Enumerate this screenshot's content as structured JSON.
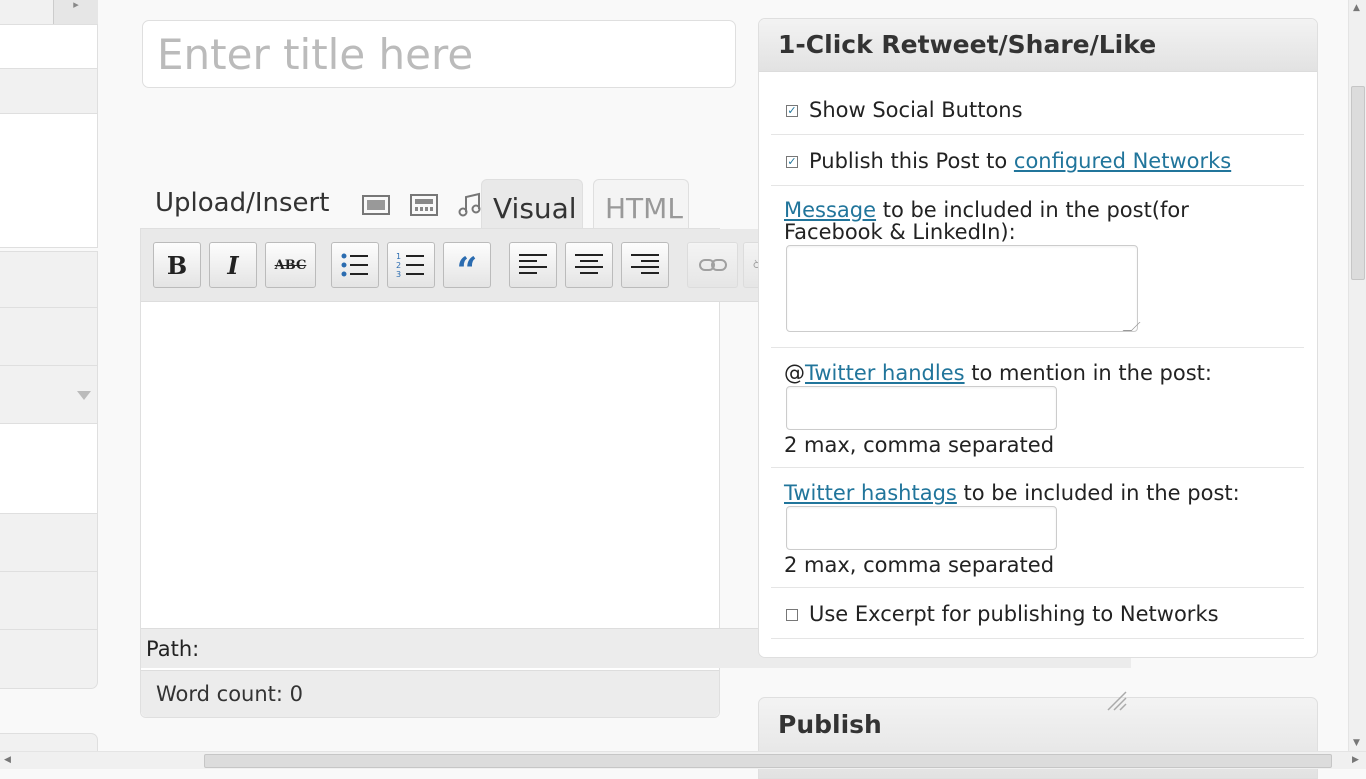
{
  "title_field": {
    "placeholder": "Enter title here",
    "value": ""
  },
  "media": {
    "label": "Upload/Insert",
    "icons": [
      "image-icon",
      "gallery-icon",
      "audio-icon"
    ]
  },
  "tabs": {
    "visual": "Visual",
    "html": "HTML"
  },
  "toolbar": {
    "buttons": [
      "bold",
      "italic",
      "strikethrough",
      "unordered-list",
      "ordered-list",
      "blockquote",
      "align-left",
      "align-center",
      "align-right",
      "insert-link",
      "unlink"
    ],
    "bold_glyph": "B",
    "italic_glyph": "I",
    "strike_glyph": "ABC",
    "quote_glyph": "“"
  },
  "editor": {
    "path_label": "Path:",
    "word_count": "Word count: 0"
  },
  "social_box": {
    "title": "1-Click Retweet/Share/Like",
    "show_social_buttons": {
      "label": "Show Social Buttons",
      "checked": true
    },
    "publish_networks": {
      "prefix": "Publish this Post to ",
      "link": "configured Networks",
      "checked": true
    },
    "message": {
      "link": "Message",
      "line1": " to be included in the post(for",
      "line2": "Facebook & LinkedIn):",
      "value": ""
    },
    "twitter_handles": {
      "at": "@",
      "link": "Twitter handles",
      "suffix": " to mention in the post:",
      "value": "",
      "hint": "2 max, comma separated"
    },
    "twitter_hashtags": {
      "link": "Twitter hashtags",
      "suffix": " to be included in the post:",
      "value": "",
      "hint": "2 max, comma separated"
    },
    "use_excerpt": {
      "label": "Use Excerpt for publishing to Networks",
      "checked": false
    }
  },
  "publish_box": {
    "title": "Publish"
  },
  "colors": {
    "link": "#21759b",
    "toolbar_bg": "#e9e9e9",
    "box_header": "#e2e2e2"
  }
}
